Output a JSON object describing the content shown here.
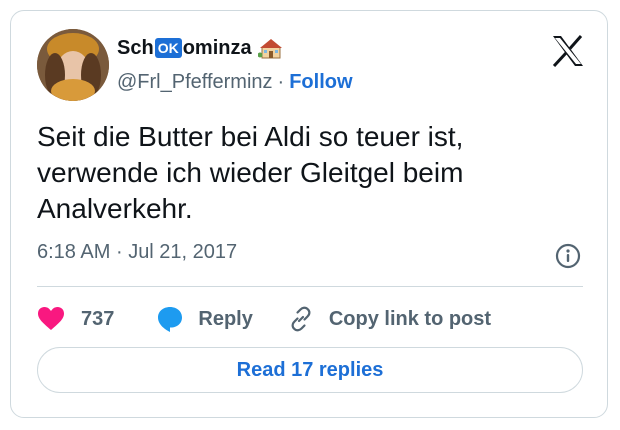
{
  "author": {
    "name_prefix": "Sch",
    "name_badge": "OK",
    "name_suffix": "ominza",
    "handle": "@Frl_Pfefferminz",
    "separator": "·",
    "follow_label": "Follow"
  },
  "tweet": {
    "lines": [
      "Seit die Butter bei Aldi so teuer ist,",
      "verwende ich wieder Gleitgel beim",
      "Analverkehr."
    ],
    "time": "6:18 AM",
    "separator": "·",
    "date": "Jul 21, 2017"
  },
  "actions": {
    "like_count": "737",
    "reply_label": "Reply",
    "copy_label": "Copy link to post"
  },
  "read_replies_label": "Read 17 replies",
  "colors": {
    "accent": "#1d6fd6",
    "like": "#f91880",
    "secondary_text": "#536471",
    "border": "#cfd9de"
  },
  "icons": [
    "house-emoji-icon",
    "x-logo-icon",
    "info-icon",
    "heart-icon",
    "reply-bubble-icon",
    "link-icon"
  ]
}
